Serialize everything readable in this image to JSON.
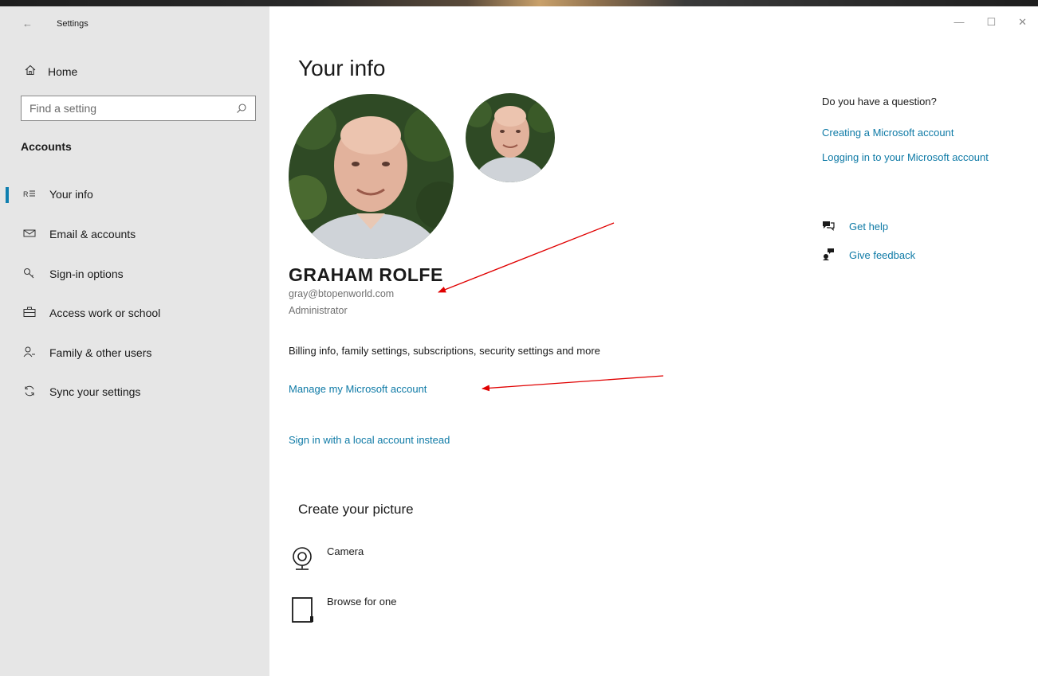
{
  "window": {
    "title": "Settings",
    "back_glyph": "←",
    "minimize_glyph": "—",
    "maximize_glyph": "☐",
    "close_glyph": "✕"
  },
  "sidebar": {
    "home_label": "Home",
    "search_placeholder": "Find a setting",
    "section_heading": "Accounts",
    "items": [
      {
        "label": "Your info",
        "icon": "person-card-icon",
        "selected": true
      },
      {
        "label": "Email & accounts",
        "icon": "mail-icon",
        "selected": false
      },
      {
        "label": "Sign-in options",
        "icon": "key-icon",
        "selected": false
      },
      {
        "label": "Access work or school",
        "icon": "briefcase-icon",
        "selected": false
      },
      {
        "label": "Family & other users",
        "icon": "person-add-icon",
        "selected": false
      },
      {
        "label": "Sync your settings",
        "icon": "sync-icon",
        "selected": false
      }
    ]
  },
  "main": {
    "title": "Your info",
    "user_name": "GRAHAM ROLFE",
    "user_email": "gray@btopenworld.com",
    "user_role": "Administrator",
    "billing_text": "Billing info, family settings, subscriptions, security settings and more",
    "manage_link": "Manage my Microsoft account",
    "local_account_link": "Sign in with a local account instead",
    "create_picture_heading": "Create your picture",
    "picture_options": [
      {
        "label": "Camera",
        "icon": "camera-icon"
      },
      {
        "label": "Browse for one",
        "icon": "document-icon"
      }
    ]
  },
  "help_panel": {
    "question_heading": "Do you have a question?",
    "links": [
      "Creating a Microsoft account",
      "Logging in to your Microsoft account"
    ],
    "get_help": "Get help",
    "give_feedback": "Give feedback"
  },
  "colors": {
    "accent": "#0e7aa6",
    "sidebar_bg": "#e6e6e6",
    "annotation_arrow": "#e00000"
  }
}
